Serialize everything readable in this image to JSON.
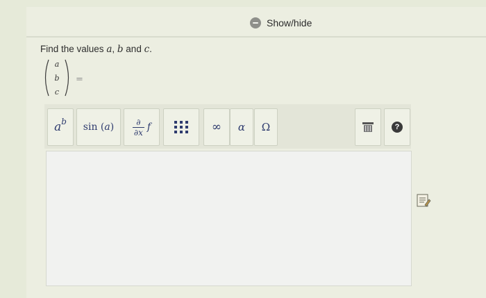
{
  "header": {
    "toggle_label": "Show/hide"
  },
  "question": {
    "prefix": "Find the values ",
    "var_a": "a",
    "sep1": ", ",
    "var_b": "b",
    "sep2": " and ",
    "var_c": "c",
    "suffix": "."
  },
  "vector": {
    "entries": [
      "a",
      "b",
      "c"
    ],
    "equals": "="
  },
  "toolbar": {
    "power": {
      "base": "a",
      "exponent": "b"
    },
    "sin": {
      "label": "sin",
      "arg": "a"
    },
    "partial": {
      "num": "∂",
      "den": "∂x",
      "func": "f"
    },
    "infinity": "∞",
    "alpha": "α",
    "omega": "Ω",
    "help": "?"
  },
  "editor": {
    "value": ""
  },
  "colors": {
    "background": "#e6ead9",
    "toolbar_text": "#2e3b6e",
    "help_button": "#3a3a3a"
  }
}
